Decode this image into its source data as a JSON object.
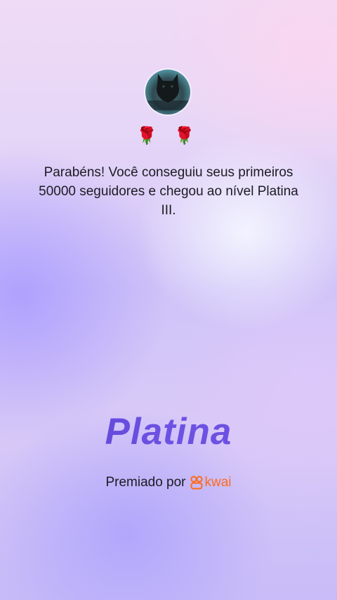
{
  "profile": {
    "avatar_name": "profile-avatar"
  },
  "decoration": {
    "roses": "🌹 🌹"
  },
  "achievement": {
    "message": "Parabéns! Você conseguiu seus primeiros 50000 seguidores e chegou ao nível Platina III.",
    "tier": "Platina"
  },
  "footer": {
    "awarded_by": "Premiado por",
    "brand": "kwai"
  },
  "colors": {
    "tier_text": "#5b43d3",
    "brand_accent": "#ff6a1a",
    "text": "#1c1b22"
  }
}
